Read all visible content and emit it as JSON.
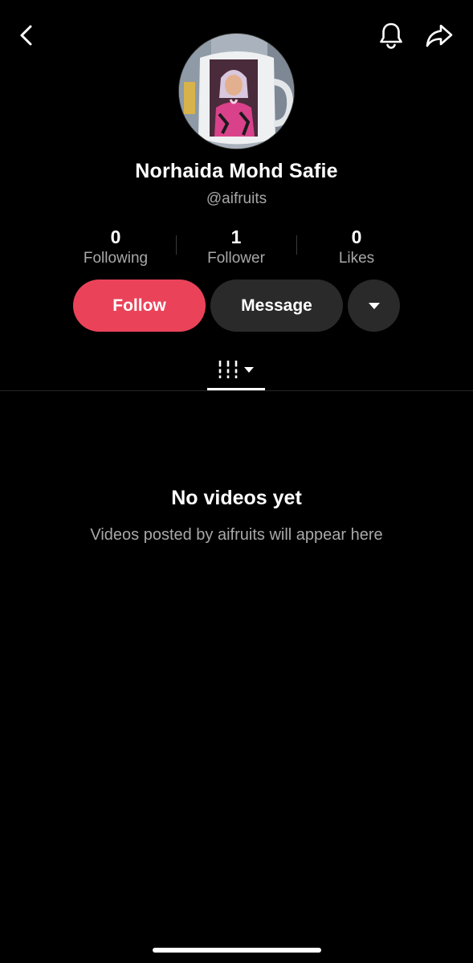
{
  "header": {
    "back_icon": "chevron-left-icon",
    "notification_icon": "bell-icon",
    "share_icon": "share-arrow-icon"
  },
  "profile": {
    "name": "Norhaida Mohd Safie",
    "handle": "@aifruits"
  },
  "stats": [
    {
      "value": "0",
      "label": "Following"
    },
    {
      "value": "1",
      "label": "Follower"
    },
    {
      "value": "0",
      "label": "Likes"
    }
  ],
  "actions": {
    "follow_label": "Follow",
    "message_label": "Message",
    "more_icon": "caret-down-icon"
  },
  "tabs": {
    "grid_icon": "videos-grid-icon",
    "dropdown_icon": "caret-down-icon"
  },
  "empty_state": {
    "title": "No videos yet",
    "subtitle": "Videos posted by aifruits will appear here"
  },
  "colors": {
    "background": "#000000",
    "follow_button": "#ea4359",
    "secondary_button": "#2a2a2a",
    "muted_text": "#a8a8a8"
  }
}
